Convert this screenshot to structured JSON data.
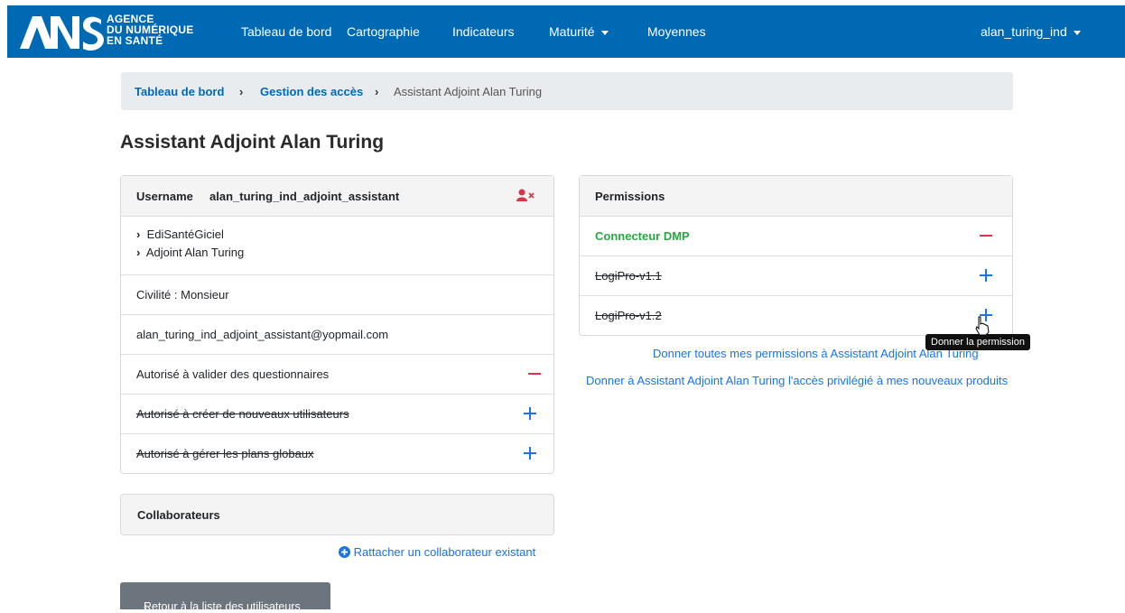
{
  "nav": {
    "logo_line1": "AGENCE",
    "logo_line2": "DU NUMÉRIQUE",
    "logo_line3": "EN SANTÉ",
    "items": [
      "Tableau de bord",
      "Cartographie",
      "Indicateurs",
      "Maturité",
      "Moyennes"
    ],
    "user": "alan_turing_ind"
  },
  "breadcrumb": {
    "home": "Tableau de bord",
    "section": "Gestion des accès",
    "current": "Assistant Adjoint Alan Turing"
  },
  "page_title": "Assistant Adjoint Alan Turing",
  "user_card": {
    "username_label": "Username",
    "username": "alan_turing_ind_adjoint_assistant",
    "orgs": [
      "EdiSantéGiciel",
      "Adjoint Alan Turing"
    ],
    "civility": "Civilité : Monsieur",
    "email": "alan_turing_ind_adjoint_assistant@yopmail.com",
    "rights": [
      {
        "label": "Autorisé à valider des questionnaires",
        "granted": true
      },
      {
        "label": "Autorisé à créer de nouveaux utilisateurs",
        "granted": false
      },
      {
        "label": "Autorisé à gérer les plans globaux",
        "granted": false
      }
    ]
  },
  "collab": {
    "title": "Collaborateurs",
    "attach_link": "Rattacher un collaborateur existant"
  },
  "permissions": {
    "title": "Permissions",
    "items": [
      {
        "label": "Connecteur DMP",
        "granted": true
      },
      {
        "label": "LogiPro-v1.1",
        "granted": false
      },
      {
        "label": "LogiPro-v1.2",
        "granted": false
      }
    ],
    "give_all_link": "Donner toutes mes permissions à Assistant Adjoint Alan Turing",
    "privileged_link": "Donner à Assistant Adjoint Alan Turing l'accès privilégié à mes nouveaux produits",
    "tooltip": "Donner la permission"
  },
  "back_button": "Retour à la liste des utilisateurs",
  "colors": {
    "nav": "#0069b4",
    "link": "#1a73e8",
    "granted": "#28a745",
    "remove": "#dc3545"
  }
}
